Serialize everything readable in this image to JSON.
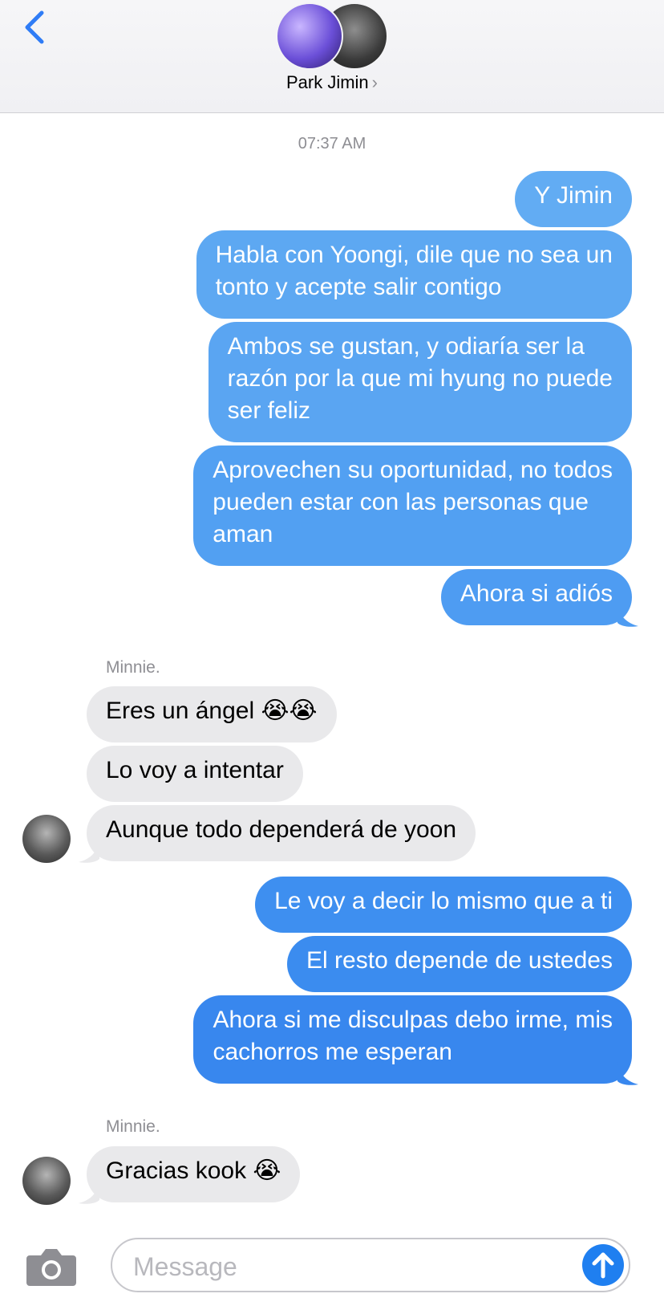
{
  "header": {
    "contact_name": "Park Jimin",
    "chevron": "›"
  },
  "timestamp": "07:37 AM",
  "messages": {
    "outgoing_1": [
      "Y Jimin"
    ],
    "outgoing_2": [
      "Habla con Yoongi, dile que no sea un",
      "tonto y acepte salir contigo"
    ],
    "outgoing_3": [
      "Ambos se gustan, y odiaría ser la",
      "razón por la que mi hyung no puede",
      "ser feliz"
    ],
    "outgoing_4": [
      "Aprovechen su oportunidad, no todos",
      "pueden estar con las personas que",
      "aman"
    ],
    "outgoing_5": [
      "Ahora si adiós"
    ],
    "sender_1": "Minnie.",
    "incoming_1": [
      "Eres un ángel 😭😭"
    ],
    "incoming_2": [
      "Lo voy a intentar"
    ],
    "incoming_3": [
      "Aunque todo dependerá de yoon"
    ],
    "outgoing_6": [
      "Le voy a decir lo mismo que a ti"
    ],
    "outgoing_7": [
      "El resto depende de ustedes"
    ],
    "outgoing_8": [
      "Ahora si me disculpas debo irme, mis",
      "cachorros me esperan"
    ],
    "sender_2": "Minnie.",
    "incoming_4": [
      "Gracias kook 😭"
    ]
  },
  "compose": {
    "placeholder": "Message"
  },
  "colors": {
    "outgoing_top": "#62acf3",
    "outgoing_bottom": "#3887ee",
    "incoming": "#e9e9eb",
    "accent": "#1f7ff0"
  },
  "icons": [
    "back-chevron-icon",
    "camera-icon",
    "send-arrow-icon"
  ]
}
